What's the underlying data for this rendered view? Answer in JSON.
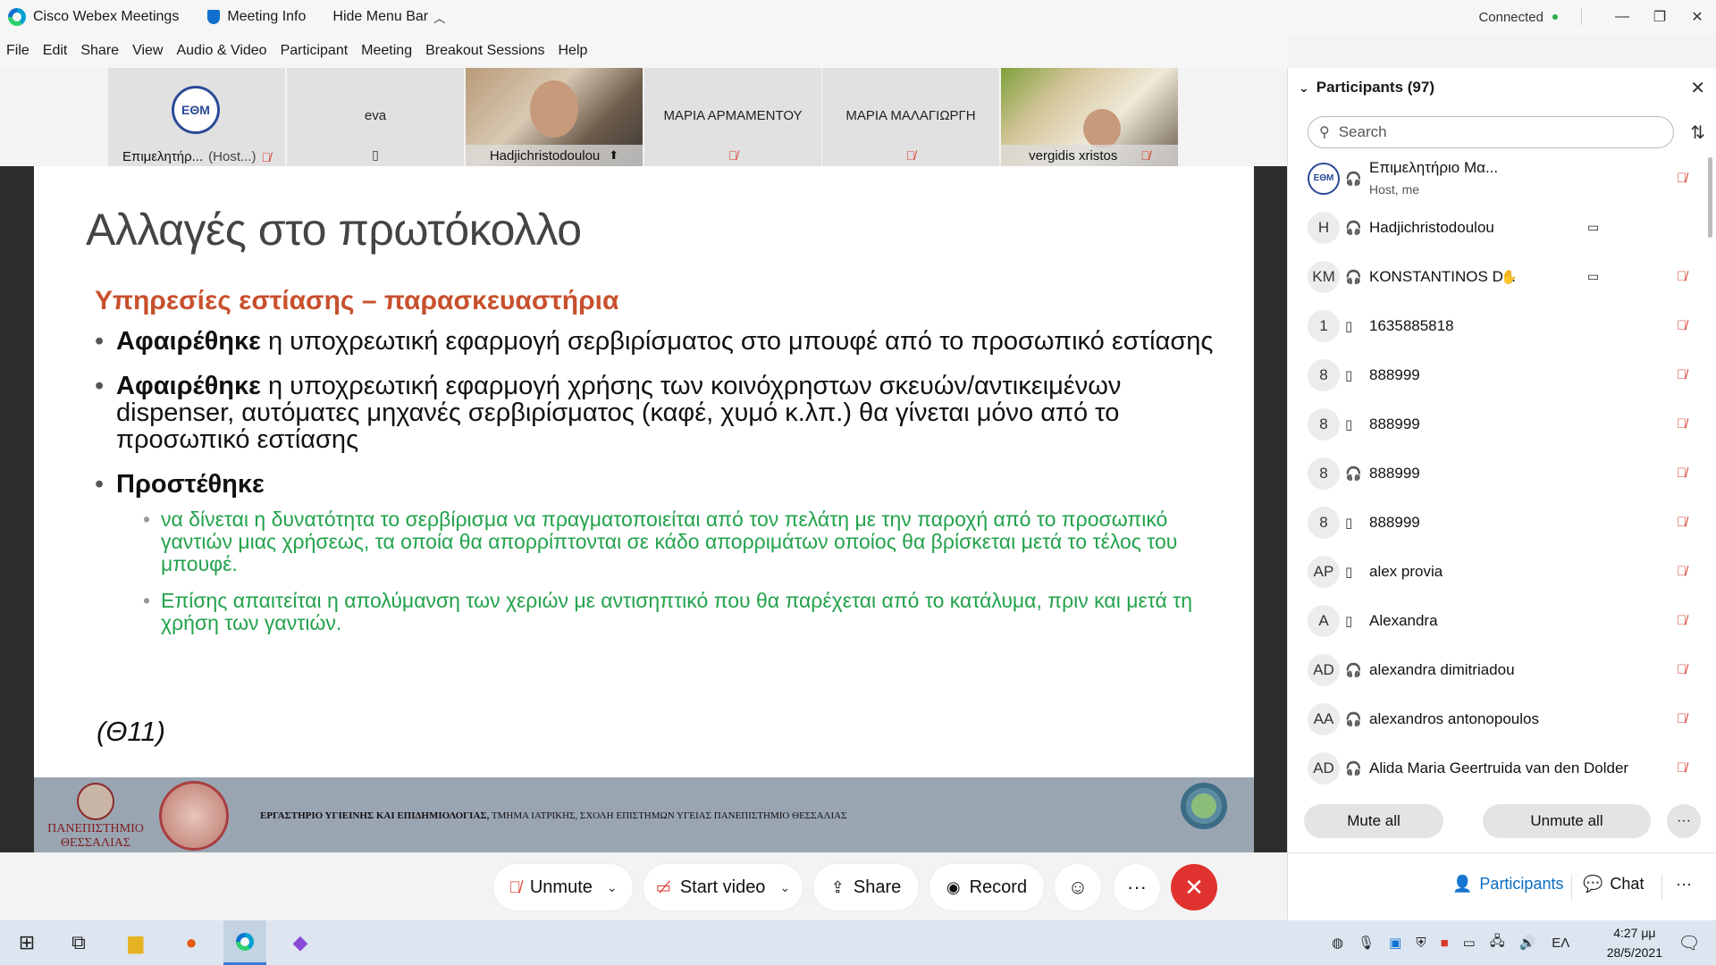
{
  "titlebar": {
    "app_name": "Cisco Webex Meetings",
    "meeting_info": "Meeting Info",
    "hide_menu": "Hide Menu Bar",
    "status": "Connected"
  },
  "menubar": [
    "File",
    "Edit",
    "Share",
    "View",
    "Audio & Video",
    "Participant",
    "Meeting",
    "Breakout Sessions",
    "Help"
  ],
  "video_strip": [
    {
      "name": "Επιμελητήρ...",
      "role": "(Host...)",
      "type": "logo",
      "logo_text": "ΕΘΜ"
    },
    {
      "name": "eva",
      "type": "phone"
    },
    {
      "name": "Hadjichristodoulou",
      "type": "video"
    },
    {
      "name": "ΜΑΡΙΑ ΑΡΜΑΜΕΝΤΟΥ",
      "type": "muted"
    },
    {
      "name": "ΜΑΡΙΑ ΜΑΛΑΓΙΩΡΓΗ",
      "type": "muted"
    },
    {
      "name": "vergidis xristos",
      "type": "video"
    }
  ],
  "slide": {
    "title": "Αλλαγές στο πρωτόκολλο",
    "subtitle": "Υπηρεσίες εστίασης – παρασκευαστήρια",
    "bullet1_bold": "Αφαιρέθηκε",
    "bullet1_text": " η υποχρεωτική εφαρμογή σερβιρίσματος στο μπουφέ από το προσωπικό εστίασης",
    "bullet2_bold": "Αφαιρέθηκε",
    "bullet2_text": " η υποχρεωτική εφαρμογή χρήσης των κοινόχρηστων σκευών/αντικειμένων dispenser, αυτόματες μηχανές σερβιρίσματος (καφέ, χυμό κ.λπ.) θα γίνεται μόνο από το προσωπικό εστίασης",
    "bullet3_bold": "Προστέθηκε",
    "sub1": "να δίνεται η δυνατότητα το σερβίρισμα να πραγματοποιείται από τον πελάτη με την παροχή από το προσωπικό γαντιών μιας χρήσεως, τα οποία θα απορρίπτονται σε κάδο απορριμάτων οποίος θα βρίσκεται μετά το τέλος του μπουφέ.",
    "sub2": "Επίσης απαιτείται η απολύμανση των χεριών με αντισηπτικό που θα παρέχεται από το κατάλυμα,  πριν και μετά τη χρήση των γαντιών.",
    "reference": "(Θ11)",
    "footer_bold": "ΕΡΓΑΣΤΗΡΙΟ ΥΓΙΕΙΝΗΣ ΚΑΙ ΕΠΙΔΗΜΙΟΛΟΓΙΑΣ,",
    "footer_rest": " ΤΜΗΜΑ ΙΑΤΡΙΚΗΣ, ΣΧΟΛΗ ΕΠΙΣΤΗΜΩΝ ΥΓΕΙΑΣ ΠΑΝΕΠΙΣΤΗΜΙΟ ΘΕΣΣΑΛΙΑΣ",
    "uni_line1": "ΠΑΝΕΠΙΣΤΗΜΙΟ",
    "uni_line2": "ΘΕΣΣΑΛΙΑΣ"
  },
  "controls": {
    "unmute": "Unmute",
    "start_video": "Start video",
    "share": "Share",
    "record": "Record"
  },
  "participants": {
    "title": "Participants (97)",
    "search_placeholder": "Search",
    "list": [
      {
        "avatar": "ΕΘΜ",
        "name": "Επιμελητήριο Μα...",
        "sub": "Host, me",
        "conn": "headset",
        "muted": true
      },
      {
        "avatar": "H",
        "name": "Hadjichristodoulou",
        "conn": "headset",
        "video": true
      },
      {
        "avatar": "KM",
        "name": "KONSTANTINOS D...",
        "conn": "headset",
        "raise": true,
        "video": true,
        "muted": true
      },
      {
        "avatar": "1",
        "name": "1635885818",
        "conn": "phone",
        "muted": true
      },
      {
        "avatar": "8",
        "name": "888999",
        "conn": "phone",
        "muted": true
      },
      {
        "avatar": "8",
        "name": "888999",
        "conn": "phone",
        "muted": true
      },
      {
        "avatar": "8",
        "name": "888999",
        "conn": "headset",
        "muted": true
      },
      {
        "avatar": "8",
        "name": "888999",
        "conn": "phone",
        "muted": true
      },
      {
        "avatar": "AP",
        "name": "alex provia",
        "conn": "phone",
        "muted": true
      },
      {
        "avatar": "A",
        "name": "Alexandra",
        "conn": "phone",
        "muted": true
      },
      {
        "avatar": "AD",
        "name": "alexandra dimitriadou",
        "conn": "headset",
        "muted": true
      },
      {
        "avatar": "AA",
        "name": "alexandros antonopoulos",
        "conn": "headset",
        "muted": true
      },
      {
        "avatar": "AD",
        "name": "Alida Maria Geertruida van den Dolder",
        "conn": "headset",
        "muted": true
      }
    ],
    "mute_all": "Mute all",
    "unmute_all": "Unmute all",
    "tab_participants": "Participants",
    "tab_chat": "Chat"
  },
  "taskbar": {
    "lang": "ΕΛ",
    "time": "4:27 μμ",
    "date": "28/5/2021"
  }
}
